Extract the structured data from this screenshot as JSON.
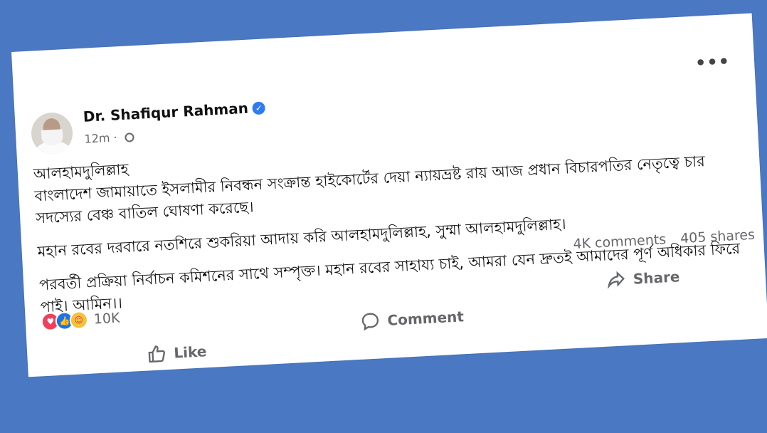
{
  "post": {
    "author": "Dr. Shafiqur Rahman",
    "verified_icon": "verified-badge-icon",
    "time": "12m",
    "visibility_icon": "globe-icon",
    "menu_icon": "more-options-icon",
    "menu_label": "•••",
    "paragraphs": [
      "আলহামদুলিল্লাহ\nবাংলাদেশ জামায়াতে ইসলামীর নিবন্ধন সংক্রান্ত হাইকোর্টের দেয়া ন্যায়ভ্রষ্ট রায় আজ প্রধান বিচারপতির নেতৃত্বে চার সদস্যের বেঞ্চ বাতিল ঘোষণা করেছে।",
      "মহান রবের দরবারে নতশিরে শুকরিয়া আদায় করি আলহামদুলিল্লাহ, সুম্মা আলহামদুলিল্লাহ।",
      "পরবর্তী প্রক্রিয়া নির্বাচন কমিশনের সাথে সম্পৃক্ত। মহান রবের সাহায্য চাই, আমরা যেন দ্রুতই আমাদের পূর্ণ অধিকার ফিরে পাই। আমিন।।"
    ]
  },
  "stats": {
    "reaction_count": "10K",
    "comments": "4K comments",
    "shares": "405 shares",
    "reaction_icons": [
      "love-reaction-icon",
      "like-reaction-icon",
      "care-reaction-icon"
    ]
  },
  "actions": {
    "like": "Like",
    "comment": "Comment",
    "share": "Share"
  },
  "colors": {
    "background": "#4a78c2",
    "card": "#ffffff",
    "facebook_blue": "#1b74e4",
    "muted_text": "#65676b"
  }
}
